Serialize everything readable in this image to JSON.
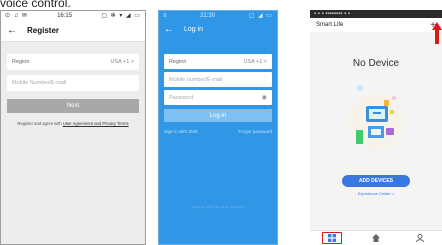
{
  "caption": "voice control.",
  "register_screen": {
    "status_left": "⊙ ♫ ✉",
    "status_time": "16:15",
    "status_right": "▢ ✻ ▾ ◢ ▭",
    "title": "Register",
    "region_label": "Region",
    "region_value": "USA +1 >",
    "mobile_placeholder": "Mobile Number/E-mail",
    "next_button": "Next",
    "agreement_prefix": "Register and agree with ",
    "agreement_link": "User Agreement and Privacy Terms"
  },
  "login_screen": {
    "status_time": "21:30",
    "status_right": "▢ ◢ ▭",
    "title": "Log in",
    "region_label": "Region",
    "region_value": "USA +1 >",
    "mobile_placeholder": "Mobile number/E-mail",
    "password_placeholder": "Password",
    "login_button": "Log in",
    "sms_link": "Sign in with SMS",
    "forgot_link": "Forgot password",
    "faint_text": "Sign in with the other account"
  },
  "home_screen": {
    "status_text": "▪ ▪ ▪   ▪▪▪▪▪▪▪▪   ▪ ▪",
    "app_title": "Smart Life",
    "add_icon": "plus-icon",
    "empty_title": "No Device",
    "add_devices_button": "ADD DEVICES",
    "experience_link": "Experience Center >",
    "tabs": [
      "home-grid-icon",
      "scene-icon",
      "profile-icon"
    ]
  },
  "colors": {
    "login_blue": "#2f97e6",
    "accent_blue": "#3a77e3",
    "highlight_red": "#d81a1a"
  }
}
